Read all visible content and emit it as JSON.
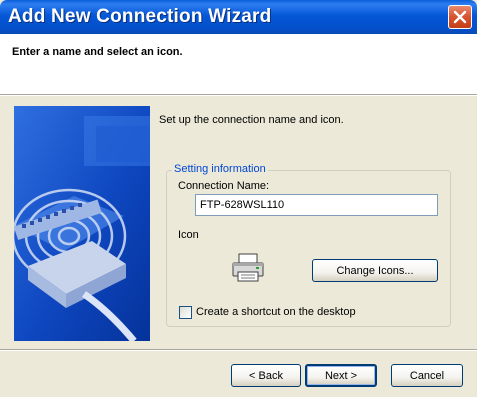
{
  "window": {
    "title": "Add New Connection Wizard",
    "close_icon": "close-icon"
  },
  "header": {
    "instruction": "Enter a name and select an icon."
  },
  "side_image": {
    "icon": "network-connection-illustration"
  },
  "main": {
    "intro": "Set up the connection name and icon.",
    "group_title": "Setting information",
    "connection_name_label": "Connection Name:",
    "connection_name_value": "FTP-628WSL110",
    "icon_label": "Icon",
    "connection_icon": "printer-icon",
    "change_icons_label": "Change Icons...",
    "shortcut_label": "Create a shortcut on the desktop",
    "shortcut_checked": false
  },
  "footer": {
    "back_label": "< Back",
    "next_label": "Next >",
    "cancel_label": "Cancel"
  },
  "colors": {
    "titlebar": "#0558D6",
    "group_title": "#0046D5",
    "close_button": "#D6542F",
    "dialog_bg": "#ECE9D8"
  }
}
